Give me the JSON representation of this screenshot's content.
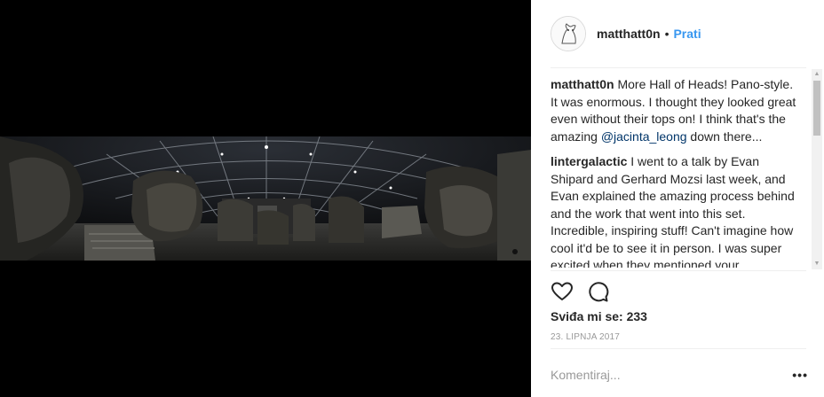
{
  "post": {
    "username": "matthatt0n",
    "separator": "•",
    "follow_label": "Prati"
  },
  "comments": [
    {
      "user": "matthatt0n",
      "text_before": " More Hall of Heads! Pano-style. It was enormous. I thought they looked great even without their tops on! I think that's the amazing ",
      "mention": "@jacinta_leong",
      "text_after": " down there..."
    },
    {
      "user": "lintergalactic",
      "text": " I went to a talk by Evan Shipard and Gerhard Mozsi last week, and Evan explained the amazing process behind and the work that went into this set. Incredible, inspiring stuff! Can't imagine how cool it'd be to see it in person. I was super excited when they mentioned your"
    }
  ],
  "likes_text": "Sviđa mi se: 233",
  "date_text": "23. LIPNJA 2017",
  "comment_placeholder": "Komentiraj...",
  "more_label": "•••",
  "icons": {
    "like": "heart-icon",
    "comment": "speech-bubble-icon"
  },
  "colors": {
    "link": "#3897f0",
    "mention": "#003569",
    "text": "#262626",
    "muted": "#999999"
  }
}
